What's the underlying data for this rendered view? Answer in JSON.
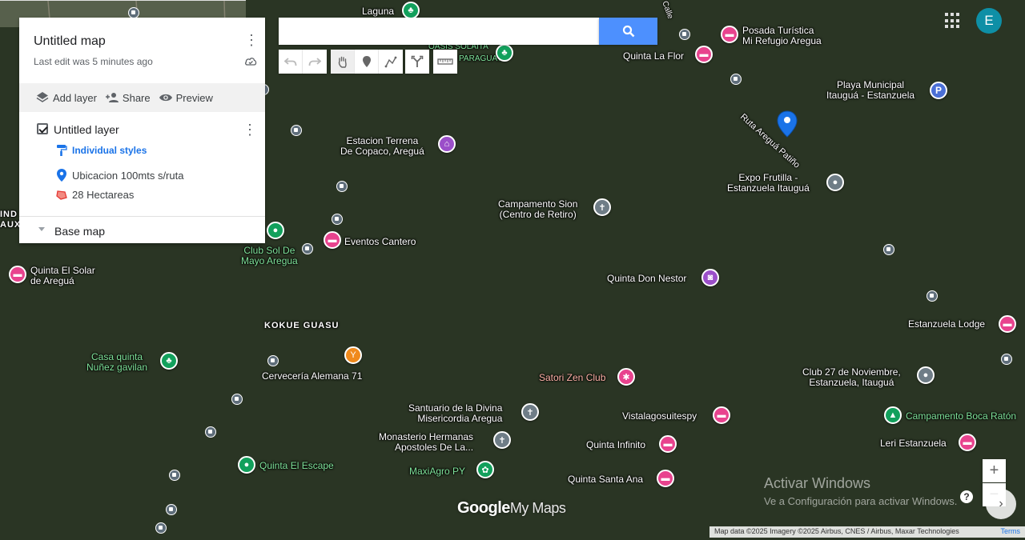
{
  "panel": {
    "title": "Untitled map",
    "last_edit": "Last edit was 5 minutes ago",
    "actions": {
      "add_layer": "Add layer",
      "share": "Share",
      "preview": "Preview"
    },
    "layer": {
      "title": "Untitled layer",
      "styles_label": "Individual styles",
      "features": [
        {
          "label": "Ubicacion 100mts s/ruta",
          "icon": "marker-icon",
          "color": "#1a73e8"
        },
        {
          "label": "28 Hectareas",
          "icon": "polygon-icon",
          "color": "#e53935"
        }
      ]
    },
    "base_map": "Base map"
  },
  "search": {
    "placeholder": "",
    "value": ""
  },
  "user": {
    "initial": "E"
  },
  "map_labels": {
    "laguna": "Laguna",
    "oasis": "OASIS SOLAITA",
    "paraguay": "PARAGUAY",
    "quinta_la_flor": "Quinta La Flor",
    "posada": "Posada Turística\nMi Refugio Aregua",
    "calle": "Calle",
    "playa": "Playa Municipal\nItauguá - Estanzuela",
    "ruta": "Ruta Areguá Patiño",
    "estacion": "Estacion Terrena\nDe Copaco, Areguá",
    "expo": "Expo Frutilla -\nEstanzuela Itauguá",
    "campamento_sion": "Campamento Sion\n(Centro de Retiro)",
    "eventos": "Eventos Cantero",
    "club_sol": "Club Sol De\nMayo Aregua",
    "quinta_solar": "Quinta El Solar\nde Areguá",
    "quinta_don_nestor": "Quinta Don Nestor",
    "kokue": "KOKUE GUASU",
    "estanzuela_lodge": "Estanzuela Lodge",
    "casa_quinta": "Casa quinta\nNuñez gavilan",
    "cerveceria": "Cervecería Alemana 71",
    "satori": "Satori Zen Club",
    "club27": "Club 27 de Noviembre,\nEstanzuela, Itauguá",
    "santuario": "Santuario de la Divina\nMisericordia Aregua",
    "vistalagos": "Vistalagosuitespy",
    "campamento_boca": "Campamento Boca Ratón",
    "monasterio": "Monasterio Hermanas\nApostoles De La...",
    "quinta_infinito": "Quinta Infinito",
    "leri": "Leri Estanzuela",
    "maxiagro": "MaxiAgro PY",
    "quinta_escape": "Quinta El Escape",
    "quinta_santa_ana": "Quinta Santa Ana",
    "ind": "IND\nAUX"
  },
  "parking_letter": "P",
  "logo": {
    "google": "Google",
    "mymaps": "My Maps"
  },
  "activate": {
    "title": "Activar Windows",
    "subtitle": "Ve a Configuración para activar Windows."
  },
  "attribution": {
    "text": "Map data ©2025 Imagery ©2025 Airbus, CNES / Airbus, Maxar Technologies",
    "terms": "Terms"
  },
  "zoom": {
    "in": "+",
    "out": "−"
  },
  "help": "?",
  "colors": {
    "polygon_fill": "#e0453c",
    "marker": "#1a73e8",
    "accent": "#4d90fe",
    "avatar": "#0e8fa6"
  }
}
